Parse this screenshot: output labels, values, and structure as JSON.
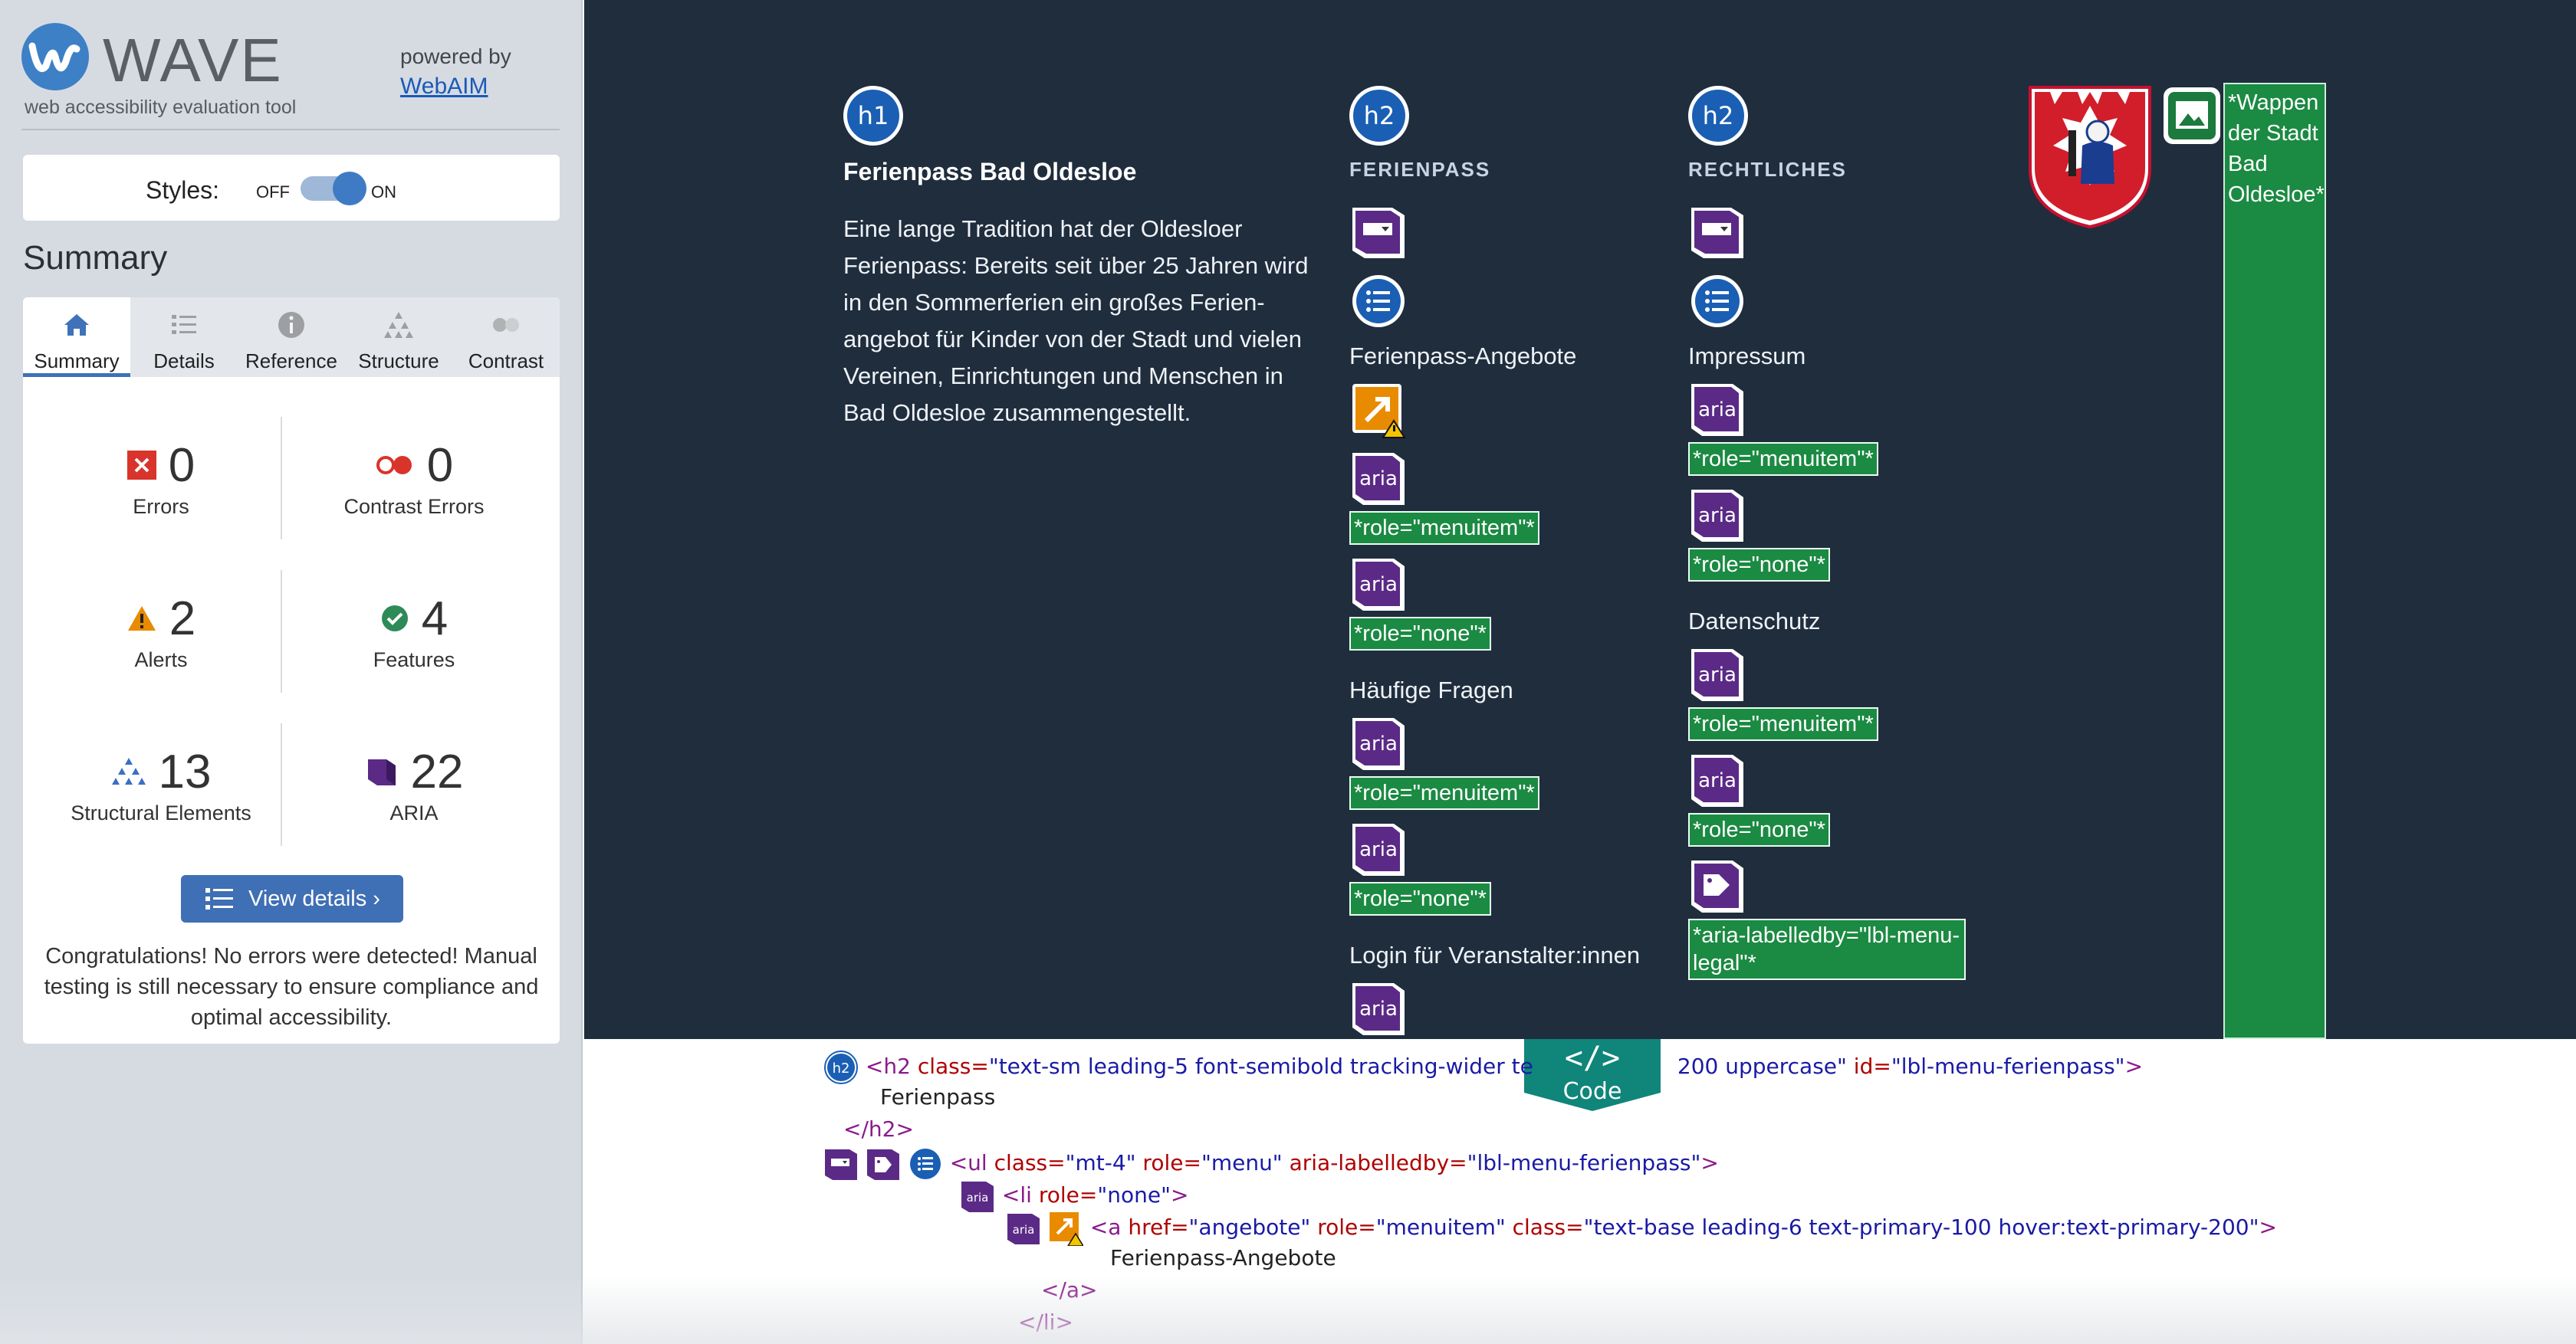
{
  "wave": {
    "logo_text": "WAVE",
    "tagline": "web accessibility evaluation tool",
    "powered_by": "powered by",
    "webaim_link": "WebAIM",
    "styles_label": "Styles:",
    "styles_off": "OFF",
    "styles_on": "ON",
    "styles_enabled": true,
    "summary_heading": "Summary",
    "tabs": [
      {
        "label": "Summary",
        "icon": "home-icon",
        "active": true
      },
      {
        "label": "Details",
        "icon": "list-icon",
        "active": false
      },
      {
        "label": "Reference",
        "icon": "info-icon",
        "active": false
      },
      {
        "label": "Structure",
        "icon": "structure-icon",
        "active": false
      },
      {
        "label": "Contrast",
        "icon": "contrast-icon",
        "active": false
      }
    ],
    "stats": {
      "errors": {
        "count": "0",
        "label": "Errors"
      },
      "contrast_errors": {
        "count": "0",
        "label": "Contrast Errors"
      },
      "alerts": {
        "count": "2",
        "label": "Alerts"
      },
      "features": {
        "count": "4",
        "label": "Features"
      },
      "structural": {
        "count": "13",
        "label": "Structural Elements"
      },
      "aria": {
        "count": "22",
        "label": "ARIA"
      }
    },
    "view_details": "View details ›",
    "congrats": "Congratulations! No errors were detected! Manual testing is still necessary to ensure compliance and optimal accessibility."
  },
  "preview": {
    "col1": {
      "badge": "h1",
      "heading": "Ferienpass Bad Oldesloe",
      "text": "Eine lange Tradition hat der Oldesloer Ferienpass: Bereits seit über 25 Jahren wird in den Sommerferien ein großes Ferien-angebot für Kinder von der Stadt und vielen Vereinen, Einrichtungen und Menschen in Bad Oldesloe zusammengestellt."
    },
    "col2": {
      "badge": "h2",
      "heading": "FERIENPASS",
      "links": [
        "Ferienpass-Angebote",
        "Häufige Fragen",
        "Login für Veranstalter:innen"
      ]
    },
    "col3": {
      "badge": "h2",
      "heading": "RECHTLICHES",
      "links": [
        "Impressum",
        "Datenschutz"
      ]
    },
    "aria_label": "aria",
    "tag_menuitem": "*role=\"menuitem\"*",
    "tag_none": "*role=\"none\"*",
    "tag_labelledby": "*aria-labelledby=\"lbl-menu-legal\"*",
    "alt_text": "*Wappen der Stadt Bad Oldesloe*"
  },
  "code": {
    "tab_label": "Code",
    "tab_symbol": "</>",
    "badge_h2": "h2",
    "badge_aria": "aria",
    "line1_open": "<h2",
    "line1_class_attr": " class=",
    "line1_class_val": "\"text-sm leading-5 font-semibold tracking-wider te",
    "line1_rest_val": "200 uppercase\"",
    "line1_id_attr": " id=",
    "line1_id_val": "\"lbl-menu-ferienpass\"",
    "line1_close": ">",
    "line2": "Ferienpass",
    "line3": "</h2>",
    "line4_open": "<ul",
    "line4_class_attr": " class=",
    "line4_class_val": "\"mt-4\"",
    "line4_role_attr": " role=",
    "line4_role_val": "\"menu\"",
    "line4_lb_attr": " aria-labelledby=",
    "line4_lb_val": "\"lbl-menu-ferienpass\"",
    "line4_close": ">",
    "line5_open": "<li",
    "line5_role_attr": " role=",
    "line5_role_val": "\"none\"",
    "line5_close": ">",
    "line6_open": "<a",
    "line6_href_attr": " href=",
    "line6_href_val": "\"angebote\"",
    "line6_role_attr": " role=",
    "line6_role_val": "\"menuitem\"",
    "line6_class_attr": " class=",
    "line6_class_val": "\"text-base leading-6 text-primary-100 hover:text-primary-200\"",
    "line6_close": ">",
    "line7": "Ferienpass-Angebote",
    "line8": "</a>",
    "line9": "</li>"
  },
  "colors": {
    "wave_blue": "#3d80c6",
    "footer_bg": "#1f2d3d",
    "aria_purple": "#5b2a86",
    "tag_green": "#1b8a42",
    "error_red": "#d9342b",
    "alert_orange": "#e88b00",
    "feature_green": "#2e8b57",
    "code_tab_teal": "#10857a"
  }
}
